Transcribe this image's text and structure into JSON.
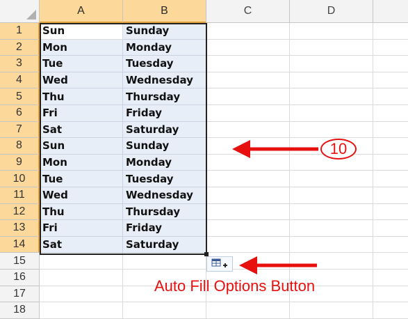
{
  "columns": [
    "A",
    "B",
    "C",
    "D"
  ],
  "rows": [
    {
      "num": "1",
      "a": "Sun",
      "b": "Sunday"
    },
    {
      "num": "2",
      "a": "Mon",
      "b": "Monday"
    },
    {
      "num": "3",
      "a": "Tue",
      "b": "Tuesday"
    },
    {
      "num": "4",
      "a": "Wed",
      "b": "Wednesday"
    },
    {
      "num": "5",
      "a": "Thu",
      "b": "Thursday"
    },
    {
      "num": "6",
      "a": "Fri",
      "b": "Friday"
    },
    {
      "num": "7",
      "a": "Sat",
      "b": "Saturday"
    },
    {
      "num": "8",
      "a": "Sun",
      "b": "Sunday"
    },
    {
      "num": "9",
      "a": "Mon",
      "b": "Monday"
    },
    {
      "num": "10",
      "a": "Tue",
      "b": "Tuesday"
    },
    {
      "num": "11",
      "a": "Wed",
      "b": "Wednesday"
    },
    {
      "num": "12",
      "a": "Thu",
      "b": "Thursday"
    },
    {
      "num": "13",
      "a": "Fri",
      "b": "Friday"
    },
    {
      "num": "14",
      "a": "Sat",
      "b": "Saturday"
    },
    {
      "num": "15",
      "a": "",
      "b": ""
    },
    {
      "num": "16",
      "a": "",
      "b": ""
    },
    {
      "num": "17",
      "a": "",
      "b": ""
    },
    {
      "num": "18",
      "a": "",
      "b": ""
    }
  ],
  "annotations": {
    "badge": "10",
    "auto_fill_label": "Auto Fill Options Button",
    "arrow_color": "#e8100f"
  },
  "colors": {
    "selected_header": "#fcd89a",
    "selected_fill": "#e8eef8",
    "grid": "#dadada"
  }
}
